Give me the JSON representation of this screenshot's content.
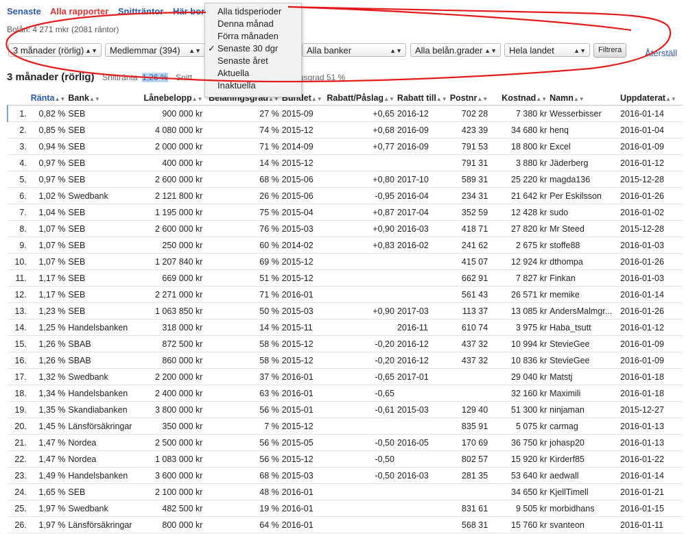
{
  "nav": {
    "items": [
      "Senaste",
      "Alla rapporter",
      "Snitträntor",
      "Här bor b"
    ]
  },
  "subinfo": "Bolån: 4 271 mkr (2081 räntor)",
  "filters": {
    "binding": "3 månader (rörlig)",
    "members": "Medlemmar (394)",
    "banks": "Alla banker",
    "ltv": "Alla belån.grader",
    "region": "Hela landet",
    "filter_button": "Filtrera",
    "reset": "Återställ"
  },
  "summary": {
    "title": "3 månader (rörlig)",
    "avg_label": "Snittränta",
    "avg_value": "1,26 %",
    "partial": "Snitt",
    "ltv_text": "elåningsgrad 51 %"
  },
  "dropdown": {
    "options": [
      "Alla tidsperioder",
      "Denna månad",
      "Förra månaden",
      "Senaste 30 dgr",
      "Senaste året",
      "Aktuella",
      "Inaktuella"
    ],
    "selected_index": 3,
    "check": "✓"
  },
  "annotation_color": "#e41b1b",
  "table": {
    "headers": [
      "",
      "Ränta",
      "Bank",
      "Lånebelopp",
      "Belåningsgrad",
      "Bundet",
      "Rabatt/Påslag",
      "Rabatt till",
      "Postnr",
      "Kostnad",
      "Namn",
      "Uppdaterat"
    ],
    "rows": [
      [
        "1.",
        "0,82 %",
        "SEB",
        "900 000 kr",
        "27 %",
        "2015-09",
        "+0,65",
        "2016-12",
        "702 28",
        "7 380 kr",
        "Wesserbisser",
        "2016-01-14"
      ],
      [
        "2.",
        "0,85 %",
        "SEB",
        "4 080 000 kr",
        "74 %",
        "2015-12",
        "+0,68",
        "2016-09",
        "423 39",
        "34 680 kr",
        "henq",
        "2016-01-04"
      ],
      [
        "3.",
        "0,94 %",
        "SEB",
        "2 000 000 kr",
        "71 %",
        "2014-09",
        "+0,77",
        "2016-09",
        "791 53",
        "18 800 kr",
        "Excel",
        "2016-01-09"
      ],
      [
        "4.",
        "0,97 %",
        "SEB",
        "400 000 kr",
        "14 %",
        "2015-12",
        "",
        "",
        "791 31",
        "3 880 kr",
        "Jäderberg",
        "2016-01-12"
      ],
      [
        "5.",
        "0,97 %",
        "SEB",
        "2 600 000 kr",
        "68 %",
        "2015-06",
        "+0,80",
        "2017-10",
        "589 31",
        "25 220 kr",
        "magda136",
        "2015-12-28"
      ],
      [
        "6.",
        "1,02 %",
        "Swedbank",
        "2 121 800 kr",
        "26 %",
        "2015-06",
        "-0,95",
        "2016-04",
        "234 31",
        "21 642 kr",
        "Per Eskilsson",
        "2016-01-26"
      ],
      [
        "7.",
        "1,04 %",
        "SEB",
        "1 195 000 kr",
        "75 %",
        "2015-04",
        "+0,87",
        "2017-04",
        "352 59",
        "12 428 kr",
        "sudo",
        "2016-01-02"
      ],
      [
        "8.",
        "1,07 %",
        "SEB",
        "2 600 000 kr",
        "76 %",
        "2015-03",
        "+0,90",
        "2016-03",
        "418 71",
        "27 820 kr",
        "Mr Steed",
        "2015-12-28"
      ],
      [
        "9.",
        "1,07 %",
        "SEB",
        "250 000 kr",
        "60 %",
        "2014-02",
        "+0,83",
        "2016-02",
        "241 62",
        "2 675 kr",
        "stoffe88",
        "2016-01-03"
      ],
      [
        "10.",
        "1,07 %",
        "SEB",
        "1 207 840 kr",
        "69 %",
        "2015-12",
        "",
        "",
        "415 07",
        "12 924 kr",
        "dthompa",
        "2016-01-26"
      ],
      [
        "11.",
        "1,17 %",
        "SEB",
        "669 000 kr",
        "51 %",
        "2015-12",
        "",
        "",
        "662 91",
        "7 827 kr",
        "Finkan",
        "2016-01-03"
      ],
      [
        "12.",
        "1,17 %",
        "SEB",
        "2 271 000 kr",
        "71 %",
        "2016-01",
        "",
        "",
        "561 43",
        "26 571 kr",
        "memike",
        "2016-01-14"
      ],
      [
        "13.",
        "1,23 %",
        "SEB",
        "1 063 850 kr",
        "50 %",
        "2015-03",
        "+0,90",
        "2017-03",
        "113 37",
        "13 085 kr",
        "AndersMalmgr...",
        "2016-01-26"
      ],
      [
        "14.",
        "1,25 %",
        "Handelsbanken",
        "318 000 kr",
        "14 %",
        "2015-11",
        "",
        "2016-11",
        "610 74",
        "3 975 kr",
        "Haba_tsutt",
        "2016-01-12"
      ],
      [
        "15.",
        "1,26 %",
        "SBAB",
        "872 500 kr",
        "58 %",
        "2015-12",
        "-0,20",
        "2016-12",
        "437 32",
        "10 994 kr",
        "StevieGee",
        "2016-01-09"
      ],
      [
        "16.",
        "1,26 %",
        "SBAB",
        "860 000 kr",
        "58 %",
        "2015-12",
        "-0,20",
        "2016-12",
        "437 32",
        "10 836 kr",
        "StevieGee",
        "2016-01-09"
      ],
      [
        "17.",
        "1,32 %",
        "Swedbank",
        "2 200 000 kr",
        "37 %",
        "2016-01",
        "-0,65",
        "2017-01",
        "",
        "29 040 kr",
        "Matstj",
        "2016-01-18"
      ],
      [
        "18.",
        "1,34 %",
        "Handelsbanken",
        "2 400 000 kr",
        "63 %",
        "2016-01",
        "-0,65",
        "",
        "",
        "32 160 kr",
        "Maximili",
        "2016-01-18"
      ],
      [
        "19.",
        "1,35 %",
        "Skandiabanken",
        "3 800 000 kr",
        "56 %",
        "2015-01",
        "-0,61",
        "2015-03",
        "129 40",
        "51 300 kr",
        "ninjaman",
        "2015-12-27"
      ],
      [
        "20.",
        "1,45 %",
        "Länsförsäkringar",
        "350 000 kr",
        "7 %",
        "2015-12",
        "",
        "",
        "835 91",
        "5 075 kr",
        "carmag",
        "2016-01-13"
      ],
      [
        "21.",
        "1,47 %",
        "Nordea",
        "2 500 000 kr",
        "56 %",
        "2015-05",
        "-0,50",
        "2016-05",
        "170 69",
        "36 750 kr",
        "johasp20",
        "2016-01-13"
      ],
      [
        "22.",
        "1,47 %",
        "Nordea",
        "1 083 000 kr",
        "56 %",
        "2015-12",
        "-0,50",
        "",
        "802 57",
        "15 920 kr",
        "Kirderf85",
        "2016-01-22"
      ],
      [
        "23.",
        "1,49 %",
        "Handelsbanken",
        "3 600 000 kr",
        "68 %",
        "2015-03",
        "-0,50",
        "2016-03",
        "281 35",
        "53 640 kr",
        "aedwall",
        "2016-01-14"
      ],
      [
        "24.",
        "1,65 %",
        "SEB",
        "2 100 000 kr",
        "48 %",
        "2016-01",
        "",
        "",
        "",
        "34 650 kr",
        "KjellTimell",
        "2016-01-21"
      ],
      [
        "25.",
        "1,97 %",
        "Swedbank",
        "482 500 kr",
        "19 %",
        "2016-01",
        "",
        "",
        "831 61",
        "9 505 kr",
        "morbidhans",
        "2016-01-15"
      ],
      [
        "26.",
        "1,97 %",
        "Länsförsäkringar",
        "800 000 kr",
        "64 %",
        "2016-01",
        "",
        "",
        "568 31",
        "15 760 kr",
        "svanteon",
        "2016-01-11"
      ]
    ]
  }
}
